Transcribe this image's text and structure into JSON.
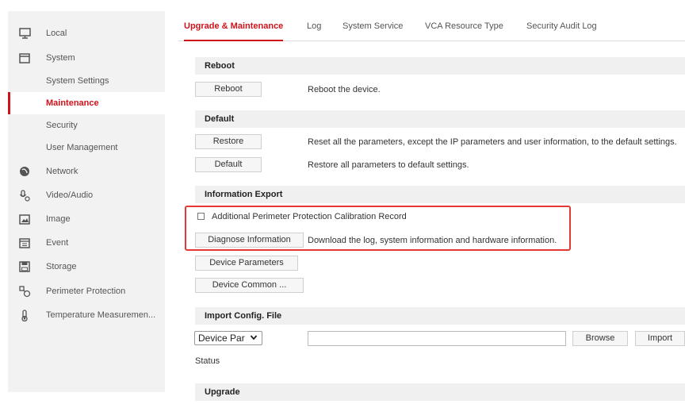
{
  "sidebar": {
    "items": [
      {
        "label": "Local",
        "icon": "monitor-icon"
      },
      {
        "label": "System",
        "icon": "window-icon"
      },
      {
        "label": "System Settings"
      },
      {
        "label": "Maintenance"
      },
      {
        "label": "Security"
      },
      {
        "label": "User Management"
      },
      {
        "label": "Network",
        "icon": "globe-icon"
      },
      {
        "label": "Video/Audio",
        "icon": "audio-icon"
      },
      {
        "label": "Image",
        "icon": "image-icon"
      },
      {
        "label": "Event",
        "icon": "calendar-icon"
      },
      {
        "label": "Storage",
        "icon": "storage-icon"
      },
      {
        "label": "Perimeter Protection",
        "icon": "perimeter-icon"
      },
      {
        "label": "Temperature Measuremen...",
        "icon": "thermometer-icon"
      }
    ]
  },
  "tabs": [
    {
      "label": "Upgrade & Maintenance"
    },
    {
      "label": "Log"
    },
    {
      "label": "System Service"
    },
    {
      "label": "VCA Resource Type"
    },
    {
      "label": "Security Audit Log"
    }
  ],
  "reboot": {
    "title": "Reboot",
    "button": "Reboot",
    "desc": "Reboot the device."
  },
  "default_section": {
    "title": "Default",
    "restore_button": "Restore",
    "restore_desc": "Reset all the parameters, except the IP parameters and user information, to the default settings.",
    "default_button": "Default",
    "default_desc": "Restore all parameters to default settings."
  },
  "export": {
    "title": "Information Export",
    "checkbox_label": "Additional Perimeter Protection Calibration Record",
    "diagnose_button": "Diagnose Information",
    "diagnose_desc": "Download the log, system information and hardware information.",
    "device_params_button": "Device Parameters",
    "device_common_button": "Device Common ..."
  },
  "import_config": {
    "title": "Import Config. File",
    "select_value": "Device Par",
    "browse_button": "Browse",
    "import_button": "Import",
    "status_label": "Status"
  },
  "upgrade": {
    "title": "Upgrade"
  },
  "colors": {
    "accent": "#d0121b",
    "highlight": "#e53935"
  }
}
